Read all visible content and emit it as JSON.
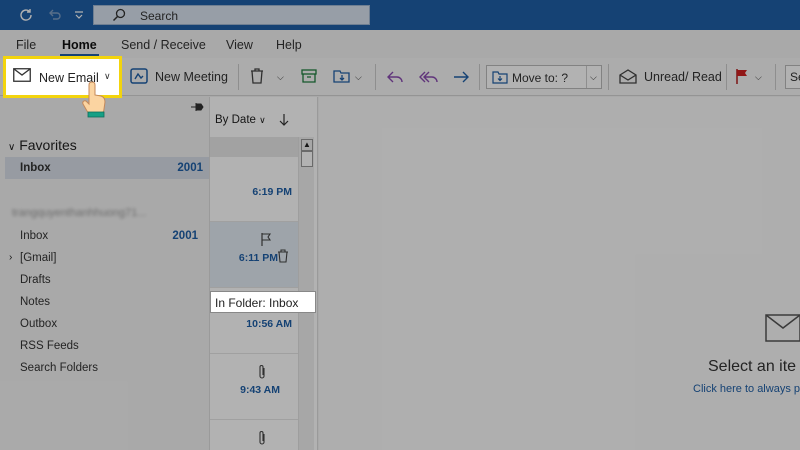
{
  "titlebar": {
    "search_placeholder": "Search"
  },
  "menu": {
    "tabs": [
      "File",
      "Home",
      "Send / Receive",
      "View",
      "Help"
    ],
    "active": "Home"
  },
  "ribbon": {
    "new_email": "New Email",
    "new_meeting": "New Meeting",
    "move_to": "Move to: ?",
    "unread_read": "Unread/ Read",
    "search_partial": "Se"
  },
  "folders": {
    "favorites_label": "Favorites",
    "favorites_inbox": {
      "label": "Inbox",
      "count": "2001"
    },
    "account_name": "trangquyenthanhhuong71...",
    "items": [
      {
        "label": "Inbox",
        "count": "2001"
      },
      {
        "label": "[Gmail]",
        "count": ""
      },
      {
        "label": "Drafts",
        "count": ""
      },
      {
        "label": "Notes",
        "count": ""
      },
      {
        "label": "Outbox",
        "count": ""
      },
      {
        "label": "RSS Feeds",
        "count": ""
      },
      {
        "label": "Search Folders",
        "count": ""
      }
    ]
  },
  "message_list": {
    "sort_label": "By Date",
    "times": [
      "6:19 PM",
      "6:11 PM",
      "10:56 AM",
      "9:43 AM"
    ],
    "tooltip": "In Folder: Inbox"
  },
  "reading_pane": {
    "select_text": "Select an ite",
    "click_text": "Click here to always pr"
  },
  "colors": {
    "accent": "#1f5fa6",
    "highlight": "#f3d40d"
  }
}
